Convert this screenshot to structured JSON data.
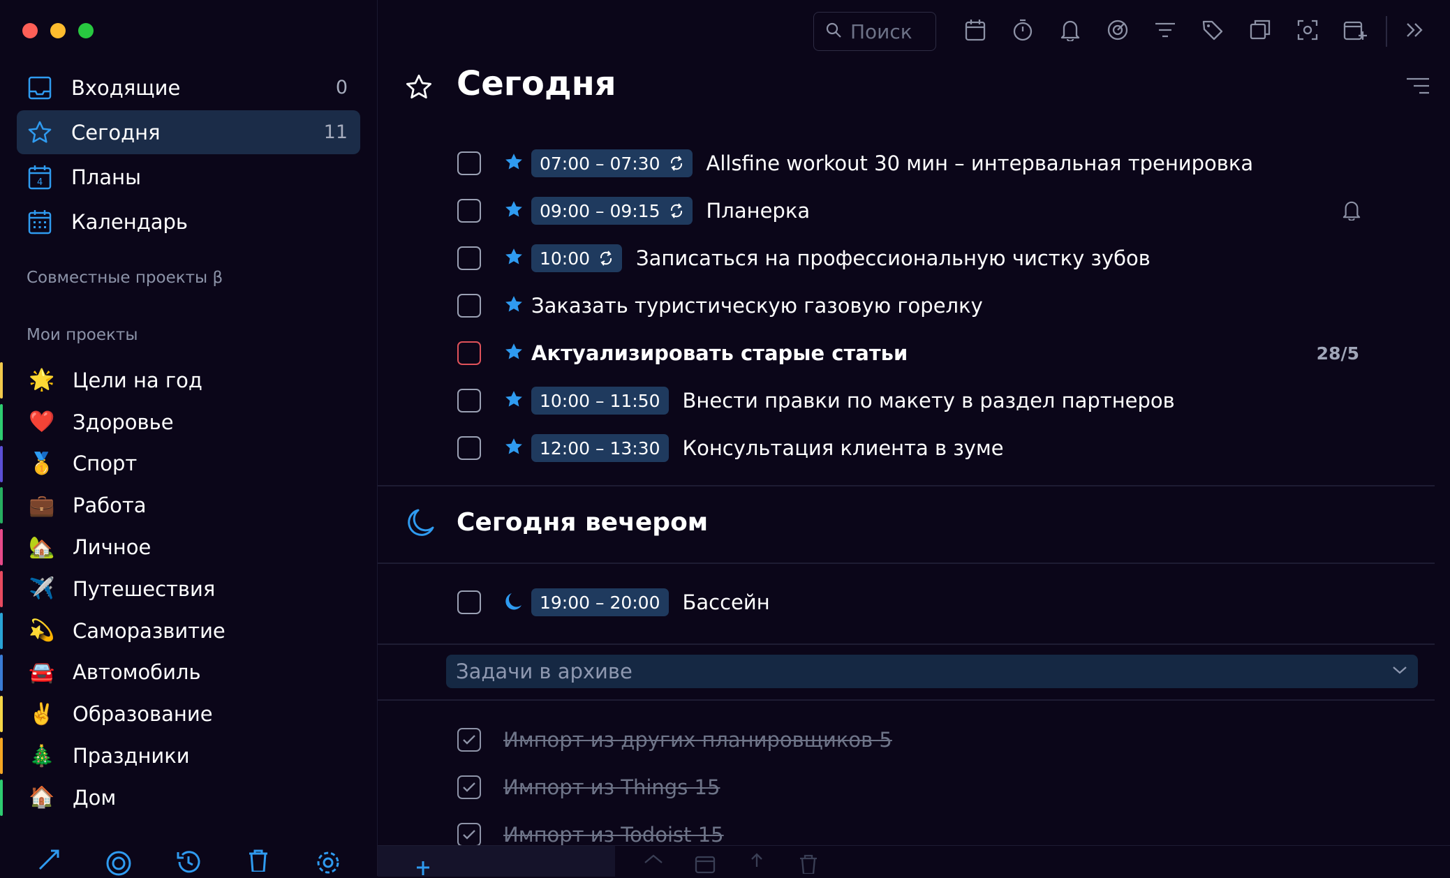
{
  "sidebar": {
    "nav": [
      {
        "label": "Входящие",
        "count": "0",
        "icon": "inbox-icon"
      },
      {
        "label": "Сегодня",
        "count": "11",
        "icon": "star-icon"
      },
      {
        "label": "Планы",
        "count": "",
        "icon": "calendar-day-icon"
      },
      {
        "label": "Календарь",
        "count": "",
        "icon": "calendar-grid-icon"
      }
    ],
    "shared_projects_label": "Совместные проекты β",
    "my_projects_label": "Мои проекты",
    "projects": [
      {
        "label": "Цели на год",
        "emoji": "🌟",
        "color": "#f2c94c"
      },
      {
        "label": "Здоровье",
        "emoji": "❤️",
        "color": "#2ecc71"
      },
      {
        "label": "Спорт",
        "emoji": "🥇",
        "color": "#5b4fd6"
      },
      {
        "label": "Работа",
        "emoji": "💼",
        "color": "#27ae60"
      },
      {
        "label": "Личное",
        "emoji": "🏡",
        "color": "#e84a8a"
      },
      {
        "label": "Путешествия",
        "emoji": "✈️",
        "color": "#e84a5f"
      },
      {
        "label": "Саморазвитие",
        "emoji": "💫",
        "color": "#29a3d6"
      },
      {
        "label": "Автомобиль",
        "emoji": "🚘",
        "color": "#3a7bd5"
      },
      {
        "label": "Образование",
        "emoji": "✌️",
        "color": "#f5d547"
      },
      {
        "label": "Праздники",
        "emoji": "🎄",
        "color": "#f5a623"
      },
      {
        "label": "Дом",
        "emoji": "🏠",
        "color": "#2ecc71"
      }
    ]
  },
  "toolbar": {
    "search_placeholder": "Поиск"
  },
  "page": {
    "title": "Сегодня"
  },
  "tasks": [
    {
      "time": "07:00 – 07:30",
      "repeat": true,
      "text": "Allsfine workout 30 мин – интервальная тренировка",
      "bold": false,
      "meta": ""
    },
    {
      "time": "09:00 – 09:15",
      "repeat": true,
      "text": "Планерка",
      "bold": false,
      "meta": "",
      "bell": true
    },
    {
      "time": "10:00",
      "repeat": true,
      "text": "Записаться на профессиональную чистку зубов",
      "bold": false,
      "meta": ""
    },
    {
      "time": "",
      "repeat": false,
      "text": "Заказать туристическую газовую горелку",
      "bold": false,
      "meta": ""
    },
    {
      "time": "",
      "repeat": false,
      "text": "Актуализировать старые статьи",
      "bold": true,
      "meta": "28/5",
      "red": true
    },
    {
      "time": "10:00 – 11:50",
      "repeat": false,
      "text": "Внести правки по макету в раздел партнеров",
      "bold": false,
      "meta": ""
    },
    {
      "time": "12:00 – 13:30",
      "repeat": false,
      "text": "Консультация клиента в зуме",
      "bold": false,
      "meta": ""
    }
  ],
  "evening": {
    "title": "Сегодня вечером",
    "tasks": [
      {
        "time": "19:00 – 20:00",
        "text": "Бассейн"
      }
    ]
  },
  "archive": {
    "label": "Задачи в архиве",
    "tasks": [
      {
        "text": "Импорт из других планировщиков 5"
      },
      {
        "text": "Импорт из Things 15"
      },
      {
        "text": "Импорт из Todoist 15"
      }
    ]
  },
  "colors": {
    "background": "#0b0619",
    "accent": "#2f9bf0",
    "active_nav": "#1b2c48",
    "badge": "#1f3a5e"
  }
}
